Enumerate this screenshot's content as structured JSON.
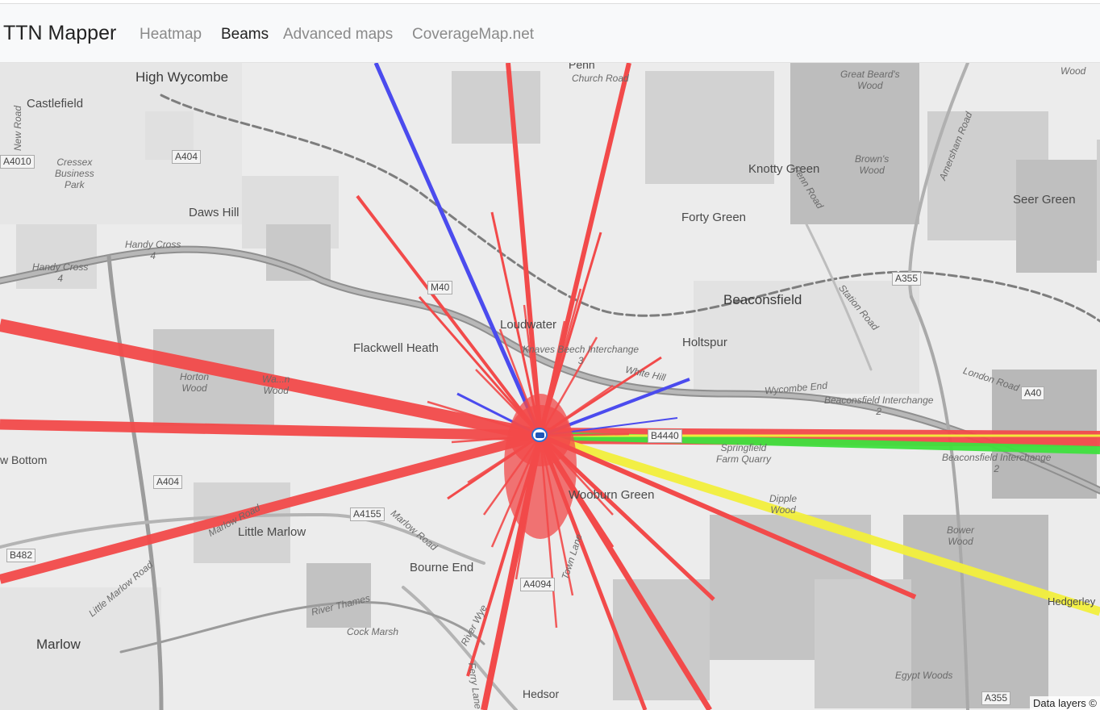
{
  "navbar": {
    "brand": "TTN Mapper",
    "links": [
      {
        "label": "Heatmap",
        "active": false
      },
      {
        "label": "Beams",
        "active": true
      },
      {
        "label": "Advanced maps",
        "active": false
      },
      {
        "label": "CoverageMap.net",
        "active": false
      }
    ]
  },
  "map": {
    "places": {
      "high_wycombe": "High Wycombe",
      "castlefield": "Castlefield",
      "cressex": "Cressex\nBusiness\nPark",
      "daws_hill": "Daws Hill",
      "handy_cross_1": "Handy Cross\n4",
      "handy_cross_2": "Handy Cross\n4",
      "penn": "Penn",
      "church_road": "Church Road",
      "great_beards_wood": "Great Beard's\nWood",
      "knotty_green": "Knotty Green",
      "browns_wood": "Brown's\nWood",
      "seer_green": "Seer Green",
      "forty_green": "Forty Green",
      "beaconsfield": "Beaconsfield",
      "loudwater": "Loudwater",
      "flackwell_heath": "Flackwell Heath",
      "knaves_beech": "Knaves Beech Interchange\n3",
      "holtspur": "Holtspur",
      "horton_wood": "Horton\nWood",
      "wa_wood": "Wa...n\nWood",
      "white_hill": "White Hill",
      "wycombe_end": "Wycombe End",
      "beaconsfield_interchange_1": "Beaconsfield Interchange\n2",
      "beaconsfield_interchange_2": "Beaconsfield Interchange\n2",
      "london_road": "London Road",
      "springfield": "Springfield\nFarm Quarry",
      "wooburn_green": "Wooburn Green",
      "dipple_wood": "Dipple\nWood",
      "bower_wood": "Bower\nWood",
      "hedgerley": "Hedgerley",
      "little_marlow": "Little Marlow",
      "bourne_end": "Bourne End",
      "marlow": "Marlow",
      "cock_marsh": "Cock Marsh",
      "river_thames": "River Thames",
      "river_wye": "River Wye",
      "hedsor": "Hedsor",
      "egypt_woods": "Egypt Woods",
      "w_bottom": "w Bottom",
      "penn_road": "Penn Road",
      "station_road": "Station Road",
      "amersham_road": "Amersham Road",
      "new_road": "New Road",
      "marlow_road": "Marlow Road",
      "little_marlow_road": "Little Marlow Road",
      "town_lane": "Town Lane",
      "ferry_lane": "Ferry Lane",
      "wood_tr": "Wood"
    },
    "roads": {
      "a404_1": "A404",
      "a404_2": "A404",
      "a4010": "A4010",
      "m40": "M40",
      "a355_1": "A355",
      "a355_2": "A355",
      "a40": "A40",
      "a4155": "A4155",
      "b482": "B482",
      "b4440": "B4440",
      "a4094": "A4094"
    },
    "attribution": "Data layers ©"
  },
  "colors": {
    "beam_red": "#f24a4a",
    "beam_blue": "#4b4bee",
    "beam_green": "#3ee03e",
    "beam_yellow": "#f2ef3c"
  }
}
